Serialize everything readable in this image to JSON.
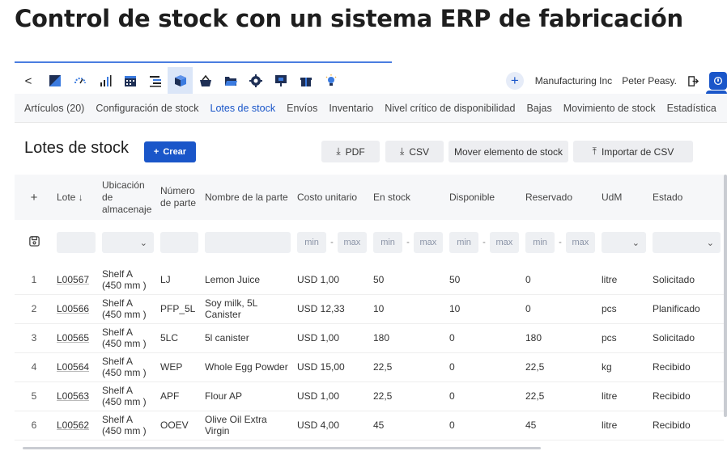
{
  "page": {
    "title": "Control de stock con un sistema ERP de fabricación"
  },
  "topbar": {
    "back_label": "<",
    "nav_icons": [
      "dashboard-icon",
      "speedometer-icon",
      "bar-chart-icon",
      "calendar-icon",
      "list-indent-icon",
      "box-icon",
      "basket-icon",
      "folder-icon",
      "gear-icon",
      "presentation-icon",
      "gift-icon",
      "lightbulb-icon"
    ],
    "add_label": "+",
    "company": "Manufacturing Inc",
    "user": "Peter Peasy."
  },
  "tabs": [
    {
      "label": "Artículos (20)",
      "active": false
    },
    {
      "label": "Configuración de stock",
      "active": false
    },
    {
      "label": "Lotes de stock",
      "active": true
    },
    {
      "label": "Envíos",
      "active": false
    },
    {
      "label": "Inventario",
      "active": false
    },
    {
      "label": "Nivel crítico de disponibilidad",
      "active": false
    },
    {
      "label": "Bajas",
      "active": false
    },
    {
      "label": "Movimiento de stock",
      "active": false
    },
    {
      "label": "Estadística",
      "active": false
    }
  ],
  "section": {
    "title": "Lotes de stock",
    "create_label": "Crear",
    "create_prefix": "+",
    "pdf_label": "PDF",
    "csv_label": "CSV",
    "move_label": "Mover elemento de stock",
    "import_label": "Importar de CSV"
  },
  "table": {
    "add_col_label": "+",
    "headers": {
      "lot": "Lote ↓",
      "location": "Ubicación de almacenaje",
      "part_number": "Número de parte",
      "part_name": "Nombre de la parte",
      "unit_cost": "Costo unitario",
      "in_stock": "En stock",
      "available": "Disponible",
      "reserved": "Reservado",
      "uom": "UdM",
      "status": "Estado"
    },
    "filter": {
      "min": "min",
      "max": "max",
      "dash": "-"
    },
    "rows": [
      {
        "n": "1",
        "lot": "L00567",
        "loc1": "Shelf A",
        "loc2": "(450 mm )",
        "pn": "LJ",
        "name": "Lemon Juice",
        "cost": "USD 1,00",
        "stock": "50",
        "avail": "50",
        "res": "0",
        "uom": "litre",
        "status": "Solicitado"
      },
      {
        "n": "2",
        "lot": "L00566",
        "loc1": "Shelf A",
        "loc2": "(450 mm )",
        "pn": "PFP_5L",
        "name": "Soy milk, 5L Canister",
        "cost": "USD 12,33",
        "stock": "10",
        "avail": "10",
        "res": "0",
        "uom": "pcs",
        "status": "Planificado"
      },
      {
        "n": "3",
        "lot": "L00565",
        "loc1": "Shelf A",
        "loc2": "(450 mm )",
        "pn": "5LC",
        "name": "5l canister",
        "cost": "USD 1,00",
        "stock": "180",
        "avail": "0",
        "res": "180",
        "uom": "pcs",
        "status": "Solicitado"
      },
      {
        "n": "4",
        "lot": "L00564",
        "loc1": "Shelf A",
        "loc2": "(450 mm )",
        "pn": "WEP",
        "name": "Whole Egg Powder",
        "cost": "USD 15,00",
        "stock": "22,5",
        "avail": "0",
        "res": "22,5",
        "uom": "kg",
        "status": "Recibido"
      },
      {
        "n": "5",
        "lot": "L00563",
        "loc1": "Shelf A",
        "loc2": "(450 mm )",
        "pn": "APF",
        "name": "Flour AP",
        "cost": "USD 1,00",
        "stock": "22,5",
        "avail": "0",
        "res": "22,5",
        "uom": "litre",
        "status": "Recibido"
      },
      {
        "n": "6",
        "lot": "L00562",
        "loc1": "Shelf A",
        "loc2": "(450 mm )",
        "pn": "OOEV",
        "name": "Olive Oil Extra Virgin",
        "cost": "USD 4,00",
        "stock": "45",
        "avail": "0",
        "res": "45",
        "uom": "litre",
        "status": "Recibido"
      }
    ]
  },
  "colors": {
    "accent": "#1a56c9",
    "tab_bg": "#f6f7f9",
    "field_bg": "#eef0f3"
  }
}
